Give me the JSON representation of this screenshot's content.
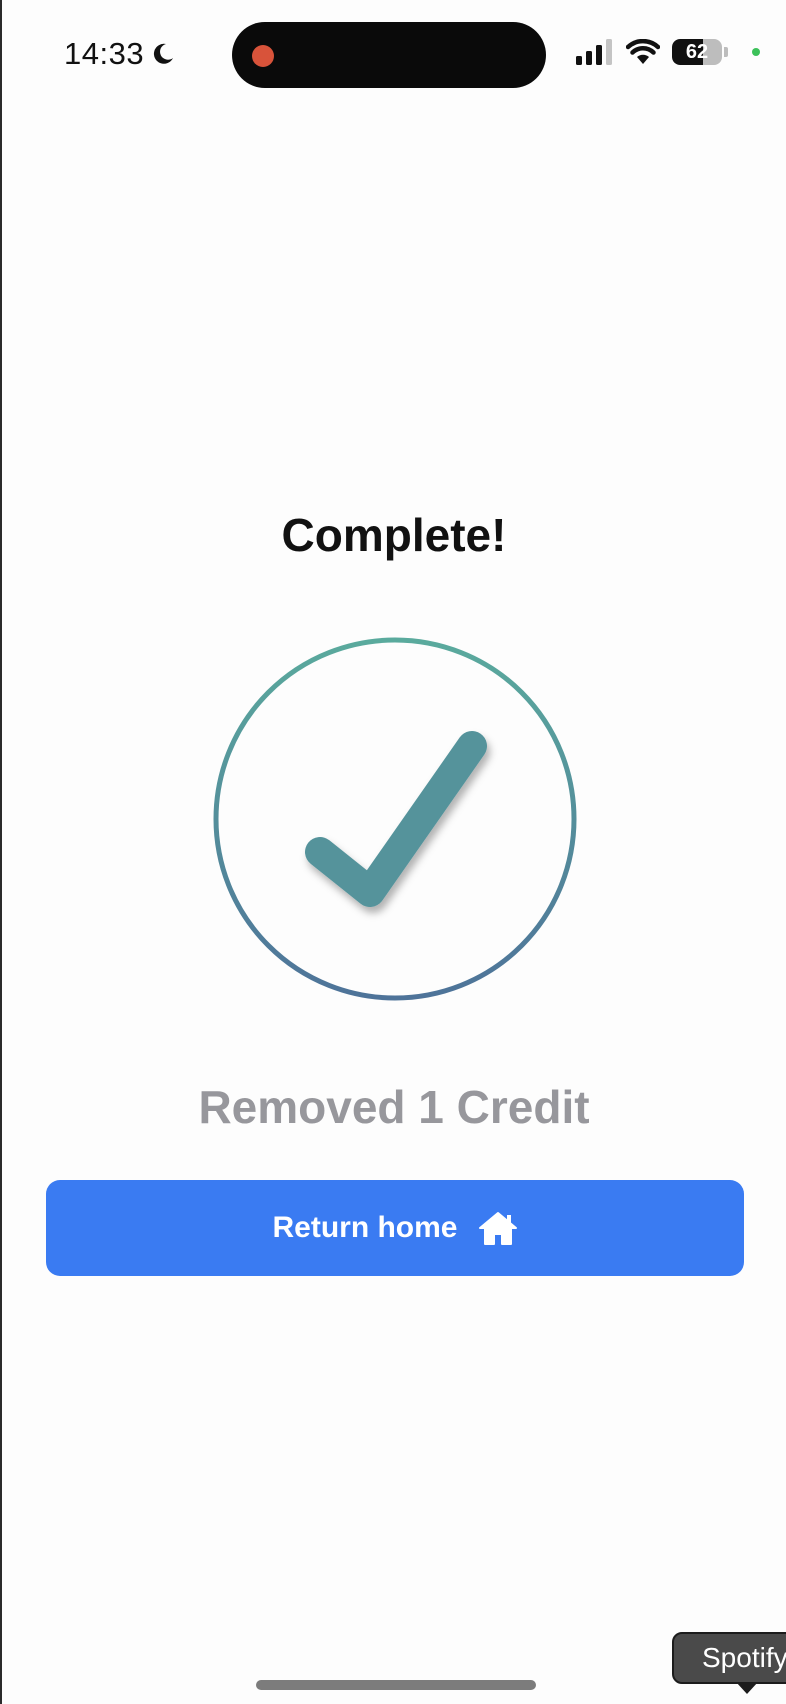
{
  "status_bar": {
    "time": "14:33",
    "focus_icon": "moon-icon",
    "recording_indicator_color": "#d8533a",
    "signal_icon": "cellular-signal-icon",
    "wifi_icon": "wifi-icon",
    "battery_level": "62",
    "battery_fraction": 0.62,
    "privacy_indicator_color": "#3cc15a"
  },
  "main": {
    "title": "Complete!",
    "status_icon": "checkmark-circle-icon",
    "subtitle": "Removed 1 Credit",
    "return_button": {
      "label": "Return home",
      "icon": "house-icon"
    }
  },
  "tooltip": {
    "text": "Spotify"
  },
  "colors": {
    "accent": "#3a7bf2",
    "check_gradient_start": "#5aaa9d",
    "check_gradient_end": "#4e7399",
    "subtitle_gray": "#97979c"
  }
}
